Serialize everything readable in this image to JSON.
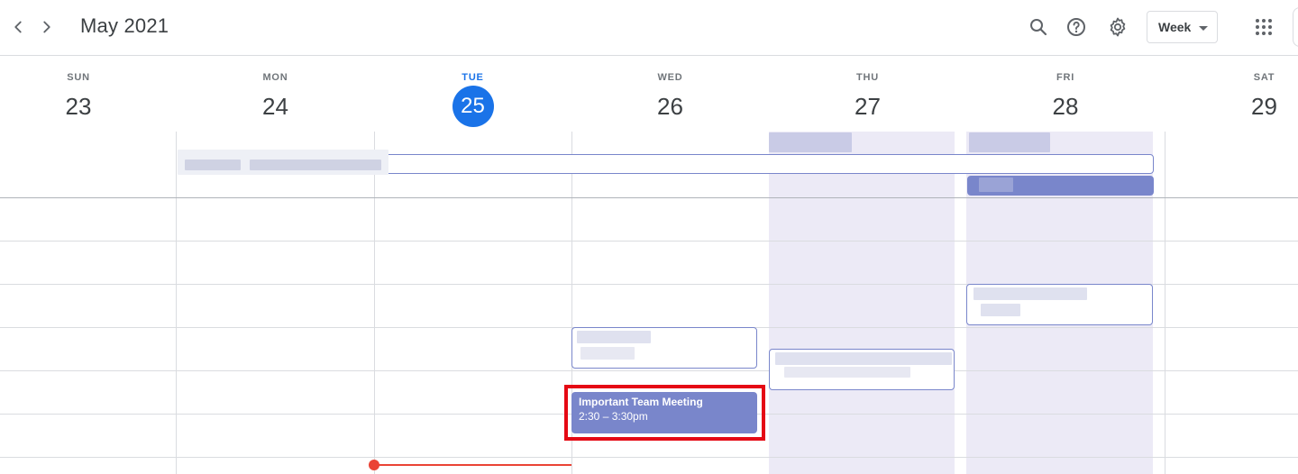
{
  "header": {
    "title": "May 2021",
    "view_label": "Week",
    "icons": [
      "chevron-left-icon",
      "chevron-right-icon",
      "search-icon",
      "help-icon",
      "settings-icon",
      "apps-grid-icon"
    ]
  },
  "days": [
    {
      "dow": "SUN",
      "date": "23"
    },
    {
      "dow": "MON",
      "date": "24"
    },
    {
      "dow": "TUE",
      "date": "25",
      "today": true
    },
    {
      "dow": "WED",
      "date": "26"
    },
    {
      "dow": "THU",
      "date": "27"
    },
    {
      "dow": "FRI",
      "date": "28"
    },
    {
      "dow": "SAT",
      "date": "29"
    }
  ],
  "event": {
    "title": "Important Team Meeting",
    "time": "2:30 – 3:30pm"
  },
  "colors": {
    "accent": "#1a73e8",
    "event": "#7986cb",
    "now_line": "#ea4335",
    "highlight": "#e50914",
    "shaded_day": "#eceaf6"
  }
}
